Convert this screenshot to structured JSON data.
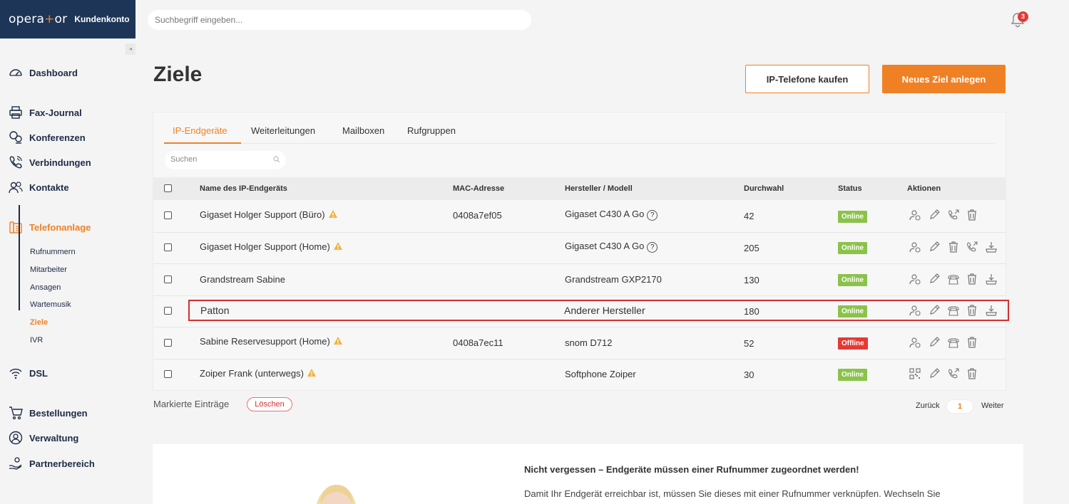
{
  "brand": {
    "logo_pre": "opera",
    "logo_plus": "+",
    "logo_post": "or",
    "subtitle": "Kundenkonto"
  },
  "topbar": {
    "search_placeholder": "Suchbegriff eingeben...",
    "notification_count": "3"
  },
  "sidebar": {
    "collapse_glyph": "◂",
    "items": [
      {
        "label": "Dashboard",
        "icon": "gauge-icon"
      },
      {
        "label": "Fax-Journal",
        "icon": "printer-icon"
      },
      {
        "label": "Konferenzen",
        "icon": "chat-users-icon"
      },
      {
        "label": "Verbindungen",
        "icon": "phone-icon"
      },
      {
        "label": "Kontakte",
        "icon": "users-icon"
      },
      {
        "label": "Telefonanlage",
        "icon": "pbx-icon"
      },
      {
        "label": "DSL",
        "icon": "wifi-icon"
      },
      {
        "label": "Bestellungen",
        "icon": "cart-icon"
      },
      {
        "label": "Verwaltung",
        "icon": "user-circle-icon"
      },
      {
        "label": "Partnerbereich",
        "icon": "handshake-icon"
      }
    ],
    "subitems": [
      "Rufnummern",
      "Mitarbeiter",
      "Ansagen",
      "Wartemusik",
      "Ziele",
      "IVR"
    ],
    "active_item": "Telefonanlage",
    "active_subitem": "Ziele"
  },
  "page": {
    "title": "Ziele",
    "btn_buy": "IP-Telefone kaufen",
    "btn_new": "Neues Ziel anlegen"
  },
  "tabs": [
    "IP-Endgeräte",
    "Weiterleitungen",
    "Mailboxen",
    "Rufgruppen"
  ],
  "table": {
    "search_placeholder": "Suchen",
    "headers": [
      "Name des IP-Endgeräts",
      "MAC-Adresse",
      "Hersteller / Modell",
      "Durchwahl",
      "Status",
      "Aktionen"
    ],
    "rows": [
      {
        "name": "Gigaset Holger Support (Büro)",
        "warn": true,
        "mac": "0408a7ef05",
        "model": "Gigaset C430 A Go",
        "help": "?",
        "ext": "42",
        "status": "Online"
      },
      {
        "name": "Gigaset Holger Support (Home)",
        "warn": true,
        "mac": "",
        "model": "Gigaset C430 A Go",
        "help": "?",
        "ext": "205",
        "status": "Online"
      },
      {
        "name": "Grandstream Sabine",
        "warn": false,
        "mac": "",
        "model": "Grandstream GXP2170",
        "help": "",
        "ext": "130",
        "status": "Online"
      },
      {
        "name": "Patton",
        "warn": false,
        "mac": "",
        "model": "Anderer Hersteller",
        "help": "",
        "ext": "180",
        "status": "Online"
      },
      {
        "name": "Sabine Reservesupport (Home)",
        "warn": true,
        "mac": "0408a7ec11",
        "model": "snom D712",
        "help": "",
        "ext": "52",
        "status": "Offline"
      },
      {
        "name": "Zoiper Frank (unterwegs)",
        "warn": true,
        "mac": "",
        "model": "Softphone Zoiper",
        "help": "",
        "ext": "30",
        "status": "Online"
      }
    ]
  },
  "footer": {
    "marked": "Markierte Einträge",
    "delete": "Löschen",
    "back": "Zurück",
    "page": "1",
    "next": "Weiter"
  },
  "info": {
    "title": "Nicht vergessen – Endgeräte müssen einer Rufnummer zugeordnet werden!",
    "text": "Damit Ihr Endgerät erreichbar ist, müssen Sie dieses mit einer Rufnummer verknüpfen. Wechseln Sie"
  },
  "colors": {
    "accent": "#f08024",
    "navy": "#1d3557",
    "online": "#8bc34a",
    "offline": "#e53935"
  }
}
